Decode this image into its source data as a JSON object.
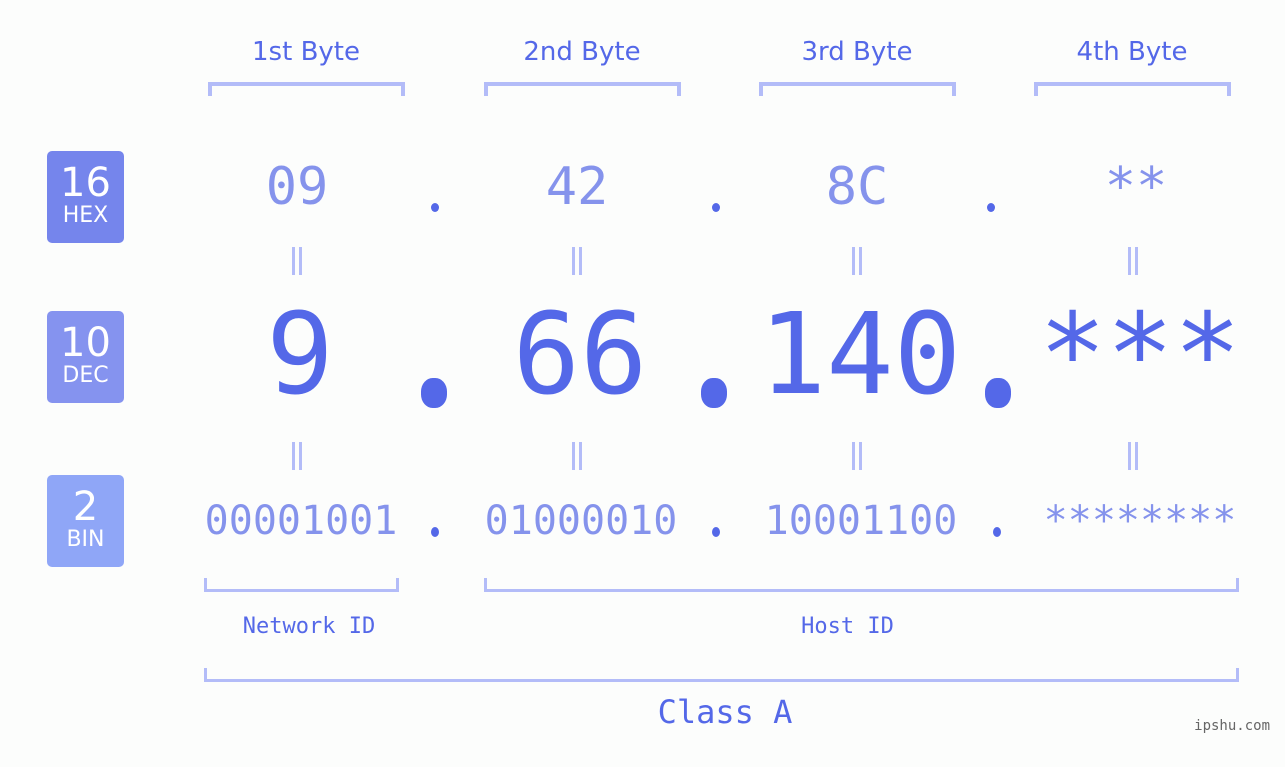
{
  "bases": [
    {
      "number": "16",
      "name": "HEX",
      "color": "#7585ec"
    },
    {
      "number": "10",
      "name": "DEC",
      "color": "#8593ef"
    },
    {
      "number": "2",
      "name": "BIN",
      "color": "#8fa6f7"
    }
  ],
  "byte_headers": [
    "1st Byte",
    "2nd Byte",
    "3rd Byte",
    "4th Byte"
  ],
  "hex": [
    "09",
    "42",
    "8C",
    "**"
  ],
  "dec": [
    "9",
    "66",
    "140",
    "***"
  ],
  "bin": [
    "00001001",
    "01000010",
    "10001100",
    "********"
  ],
  "separator": ".",
  "equals_symbol": "=",
  "network_id_label": "Network ID",
  "host_id_label": "Host ID",
  "class_label": "Class A",
  "watermark": "ipshu.com",
  "colors": {
    "primary": "#5468e8",
    "secondary": "#8593ec",
    "bracket": "#b3bcf8",
    "background": "#fcfdfc"
  }
}
